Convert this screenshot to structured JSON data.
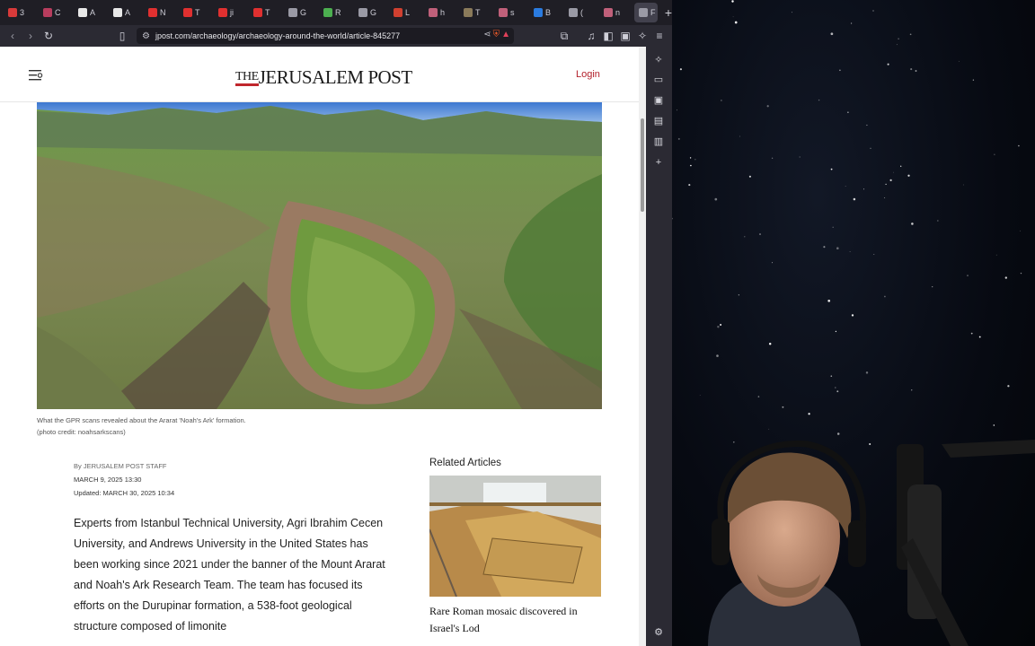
{
  "browser": {
    "tabs": [
      {
        "label": "3",
        "color": "#d83a3a"
      },
      {
        "label": "C",
        "color": "#b83d5e"
      },
      {
        "label": "A",
        "color": "#e8e8e8"
      },
      {
        "label": "A",
        "color": "#e8e8e8"
      },
      {
        "label": "N",
        "color": "#e03030"
      },
      {
        "label": "T",
        "color": "#e03030"
      },
      {
        "label": "ji",
        "color": "#e03030"
      },
      {
        "label": "T",
        "color": "#e03030"
      },
      {
        "label": "G",
        "color": "#9a9aa5"
      },
      {
        "label": "R",
        "color": "#4caf50"
      },
      {
        "label": "G",
        "color": "#9a9aa5"
      },
      {
        "label": "L",
        "color": "#d04030"
      },
      {
        "label": "h",
        "color": "#c0607a"
      },
      {
        "label": "T",
        "color": "#8a7a5a"
      },
      {
        "label": "s",
        "color": "#c0607a"
      },
      {
        "label": "B",
        "color": "#2a7be0"
      },
      {
        "label": "(",
        "color": "#9a9aa5"
      },
      {
        "label": "n",
        "color": "#c0607a"
      }
    ],
    "active_tab_label": "F",
    "new_tab_symbol": "+",
    "url": "jpost.com/archaeology/archaeology-around-the-world/article-845277"
  },
  "page": {
    "logo_the": "THE",
    "logo_text": "JERUSALEM POST",
    "login_label": "Login",
    "caption_line1": "What the GPR scans revealed about the Ararat 'Noah's Ark' formation.",
    "caption_line2": "(photo credit: noahsarkscans)",
    "byline": "By JERUSALEM POST STAFF",
    "published": "MARCH 9, 2025 13:30",
    "updated": "Updated: MARCH 30, 2025 10:34",
    "body": "Experts from Istanbul Technical University, Agri Ibrahim Cecen University, and Andrews University in the United States has been working since 2021 under the banner of the Mount Ararat and Noah's Ark Research Team. The team has focused its efforts on the Durupinar formation, a 538-foot geological structure composed of limonite",
    "related_heading": "Related Articles",
    "related_title": "Rare Roman mosaic discovered in Israel's Lod"
  },
  "colors": {
    "brand_red": "#b3212b",
    "logo_red": "#c0272d"
  }
}
